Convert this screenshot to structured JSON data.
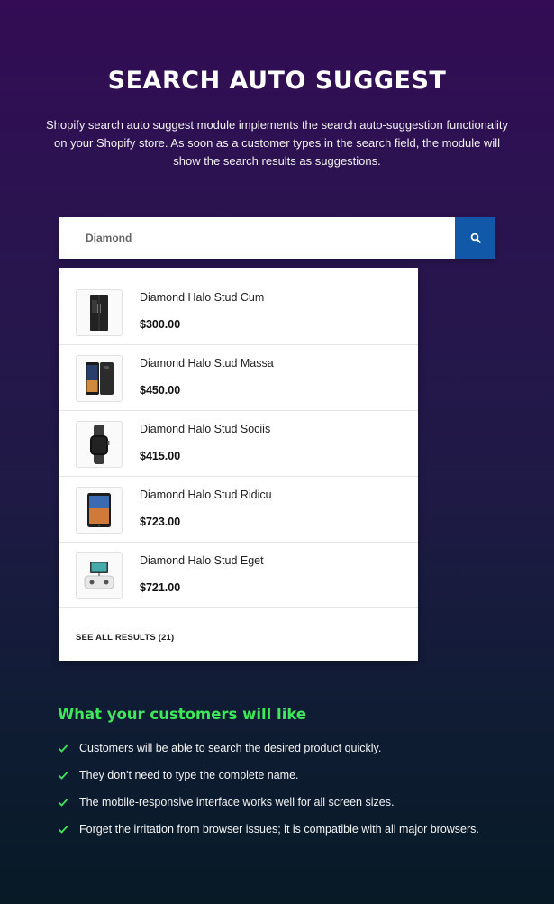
{
  "header": {
    "title": "SEARCH AUTO SUGGEST",
    "description": "Shopify search auto suggest module implements the search auto-suggestion functionality on your Shopify store. As soon as a customer types in the search field, the module will show the search results as suggestions."
  },
  "search": {
    "value": "Diamond",
    "button_icon": "search-icon",
    "button_color": "#1158a8"
  },
  "results": {
    "items": [
      {
        "name": "Diamond Halo Stud Cum",
        "price": "$300.00",
        "image": "refrigerator"
      },
      {
        "name": "Diamond Halo Stud Massa",
        "price": "$450.00",
        "image": "smartphone"
      },
      {
        "name": "Diamond Halo Stud Sociis",
        "price": "$415.00",
        "image": "smartwatch"
      },
      {
        "name": "Diamond Halo Stud Ridicu",
        "price": "$723.00",
        "image": "tablet"
      },
      {
        "name": "Diamond Halo Stud Eget",
        "price": "$721.00",
        "image": "drone-controller"
      }
    ],
    "see_all": "SEE ALL RESULTS (21)"
  },
  "features": {
    "title": "What your customers will like",
    "accent_color": "#3ee85a",
    "items": [
      "Customers will be able to search the desired product quickly.",
      "They don't need to type the complete name.",
      "The mobile-responsive interface works well for all screen sizes.",
      "Forget the irritation from browser issues; it is compatible with all major browsers."
    ]
  }
}
